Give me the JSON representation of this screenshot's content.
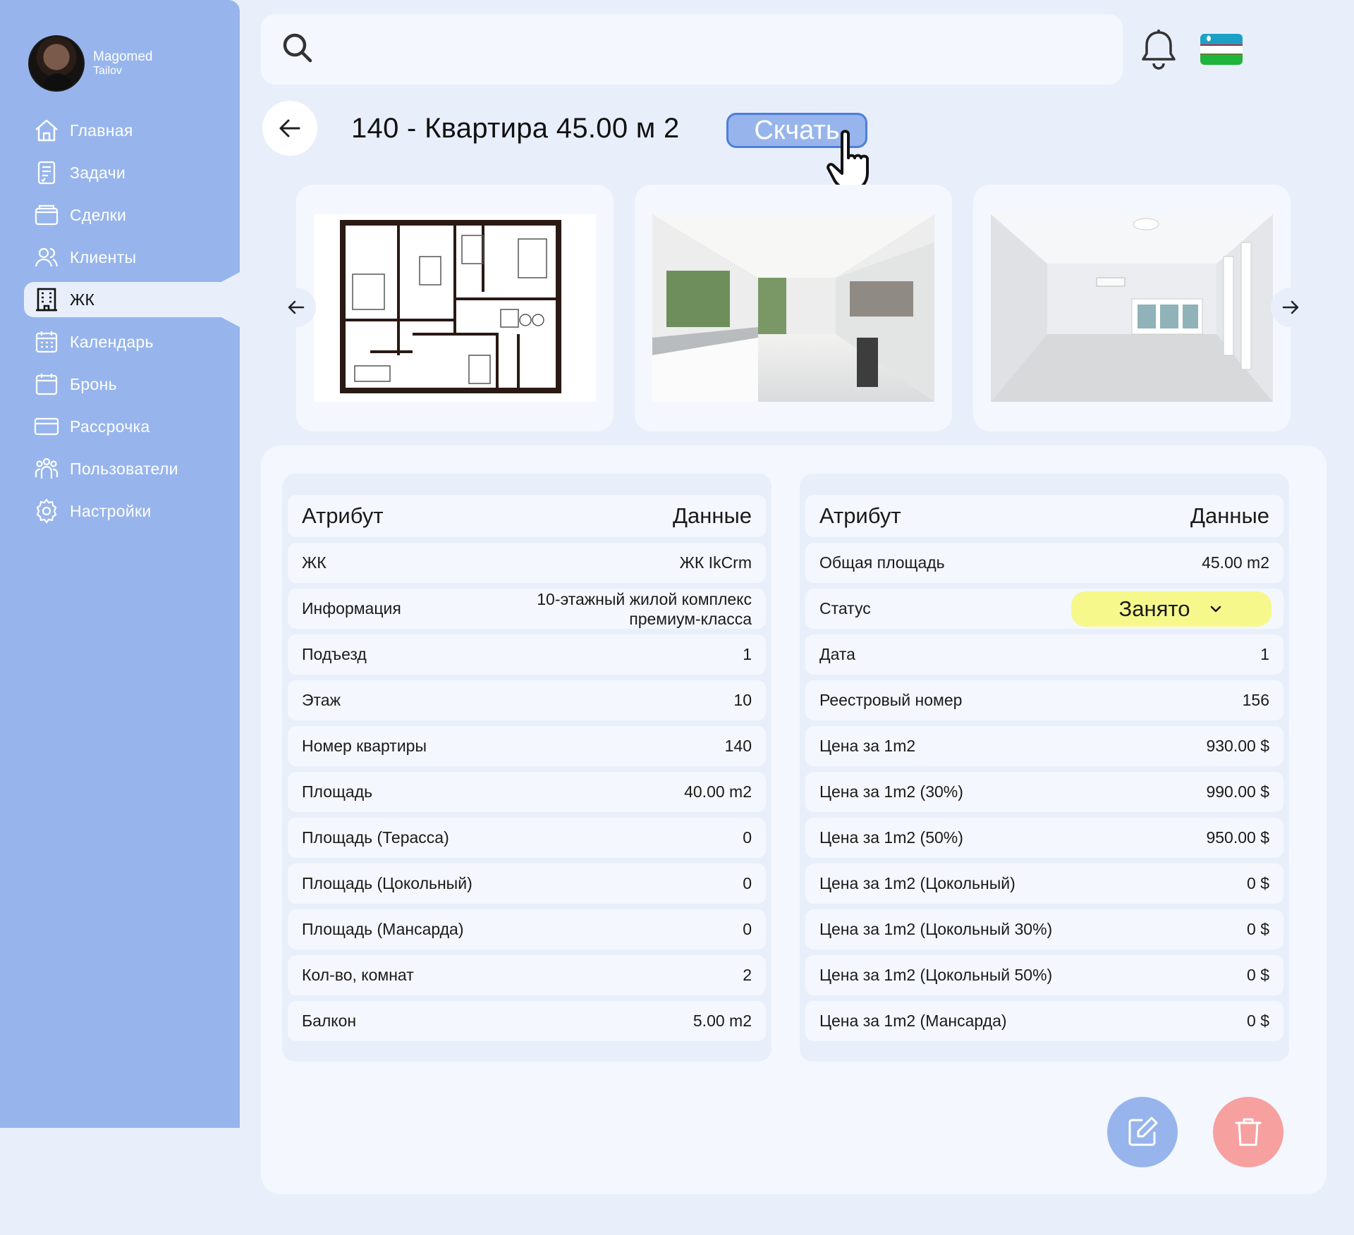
{
  "user": {
    "first_name": "Magomed",
    "last_name": "Tailov"
  },
  "sidebar": {
    "items": [
      {
        "label": "Главная",
        "icon": "home-icon"
      },
      {
        "label": "Задачи",
        "icon": "tasks-icon"
      },
      {
        "label": "Сделки",
        "icon": "wallet-icon"
      },
      {
        "label": "Клиенты",
        "icon": "clients-icon"
      },
      {
        "label": "ЖК",
        "icon": "building-icon",
        "active": true
      },
      {
        "label": "Календарь",
        "icon": "calendar-icon"
      },
      {
        "label": "Бронь",
        "icon": "booking-icon"
      },
      {
        "label": "Рассрочка",
        "icon": "card-icon"
      },
      {
        "label": "Пользователи",
        "icon": "users-icon"
      },
      {
        "label": "Настройки",
        "icon": "settings-icon"
      }
    ]
  },
  "header": {
    "title": "140 - Квартира 45.00 м 2",
    "download_label": "Скчать"
  },
  "left_table": {
    "col_attr": "Атрибут",
    "col_data": "Данные",
    "rows": [
      {
        "k": "ЖК",
        "v": "ЖК IkCrm"
      },
      {
        "k": "Информация",
        "v1": "10-этажный жилой комплекс",
        "v2": "премиум-класса"
      },
      {
        "k": "Подъезд",
        "v": "1"
      },
      {
        "k": "Этаж",
        "v": "10"
      },
      {
        "k": "Номер квартиры",
        "v": "140"
      },
      {
        "k": "Площадь",
        "v": "40.00 m2"
      },
      {
        "k": "Площадь (Терасса)",
        "v": "0"
      },
      {
        "k": "Площадь (Цокольный)",
        "v": "0"
      },
      {
        "k": "Площадь (Мансарда)",
        "v": "0"
      },
      {
        "k": "Кол-во, комнат",
        "v": "2"
      },
      {
        "k": "Балкон",
        "v": "5.00 m2"
      }
    ]
  },
  "right_table": {
    "col_attr": "Атрибут",
    "col_data": "Данные",
    "status_label": "Статус",
    "status_value": "Занято",
    "status_color": "#F6F88C",
    "rows": [
      {
        "k": "Общая площадь",
        "v": "45.00 m2"
      },
      {
        "k": "Дата",
        "v": "1"
      },
      {
        "k": "Реестровый номер",
        "v": "156"
      },
      {
        "k": "Цена за 1m2",
        "v": "930.00 $"
      },
      {
        "k": "Цена за 1m2 (30%)",
        "v": "990.00 $"
      },
      {
        "k": "Цена за 1m2 (50%)",
        "v": "950.00 $"
      },
      {
        "k": "Цена за 1m2 (Цокольный)",
        "v": "0 $"
      },
      {
        "k": "Цена за 1m2 (Цокольный 30%)",
        "v": "0 $"
      },
      {
        "k": "Цена за 1m2 (Цокольный 50%)",
        "v": "0 $"
      },
      {
        "k": "Цена за 1m2 (Мансарда)",
        "v": "0 $"
      }
    ]
  },
  "colors": {
    "sidebar": "#97B5EC",
    "background": "#E8EFFB",
    "accent": "#4E7EDB",
    "delete": "#F6A0A0"
  }
}
